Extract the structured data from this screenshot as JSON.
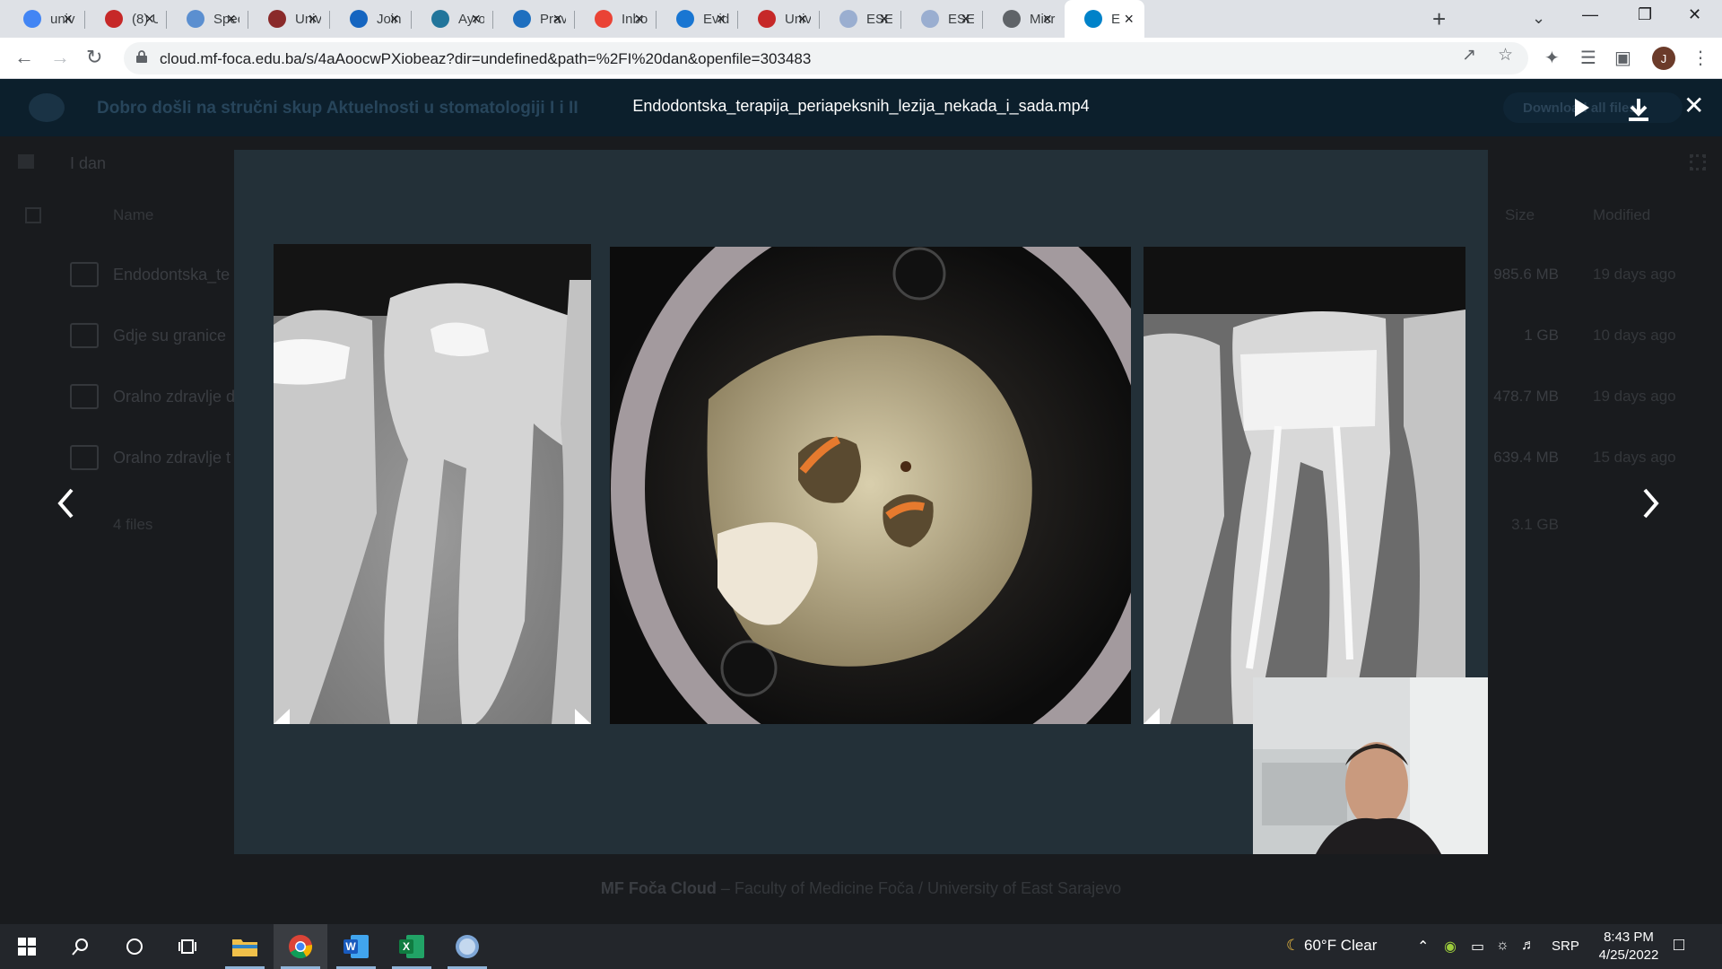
{
  "browser": {
    "tabs": [
      {
        "label": "univ",
        "icon": "google-icon",
        "color": "#4285f4"
      },
      {
        "label": "(8) U",
        "icon": "uni-logo-icon",
        "color": "#c62828"
      },
      {
        "label": "Spec",
        "icon": "tooth-icon",
        "color": "#5b8fd0"
      },
      {
        "label": "Univ",
        "icon": "crest-icon",
        "color": "#8a2a2a"
      },
      {
        "label": "Join",
        "icon": "edge-icon",
        "color": "#1565c0"
      },
      {
        "label": "Ayro",
        "icon": "wordpress-icon",
        "color": "#21759b"
      },
      {
        "label": "Pravi",
        "icon": "building-icon",
        "color": "#1e6fbf"
      },
      {
        "label": "Inbo",
        "icon": "gmail-icon",
        "color": "#ea4335"
      },
      {
        "label": "Evid",
        "icon": "diamond-icon",
        "color": "#1976d2"
      },
      {
        "label": "Univ",
        "icon": "uni-logo-icon",
        "color": "#c62828"
      },
      {
        "label": "ESE 2",
        "icon": "flag-icon",
        "color": "#9aaed0"
      },
      {
        "label": "ESE 2",
        "icon": "flag-icon",
        "color": "#9aaed0"
      },
      {
        "label": "Micr",
        "icon": "globe-icon",
        "color": "#5f6368"
      },
      {
        "label": "E",
        "icon": "nextcloud-icon",
        "color": "#0082c9"
      }
    ],
    "url": "cloud.mf-foca.edu.ba/s/4aAoocwPXiobeaz?dir=undefined&path=%2FI%20dan&openfile=303483",
    "profile_initial": "J"
  },
  "nextcloud": {
    "share_title": "Dobro došli na stručni skup Aktuelnosti u stomatologiji I i II",
    "download_all": "Download all files",
    "breadcrumb": "I dan",
    "columns": {
      "name": "Name",
      "size": "Size",
      "modified": "Modified"
    },
    "files": [
      {
        "name": "Endodontska_te",
        "size": "985.6 MB",
        "modified": "19 days ago"
      },
      {
        "name": "Gdje su granice",
        "size": "1 GB",
        "modified": "10 days ago"
      },
      {
        "name": "Oralno zdravlje d",
        "size": "478.7 MB",
        "modified": "19 days ago"
      },
      {
        "name": "Oralno zdravlje t",
        "size": "639.4 MB",
        "modified": "15 days ago"
      }
    ],
    "summary": {
      "count": "4 files",
      "total": "3.1 GB"
    },
    "footer": {
      "brand": "MF Foča Cloud",
      "rest": " – Faculty of Medicine Foča / University of East Sarajevo"
    }
  },
  "viewer": {
    "filename": "Endodontska_terapija_periapeksnih_lezija_nekada_i_sada.mp4"
  },
  "taskbar": {
    "weather": "60°F  Clear",
    "language": "SRP",
    "time": "8:43 PM",
    "date": "4/25/2022"
  }
}
